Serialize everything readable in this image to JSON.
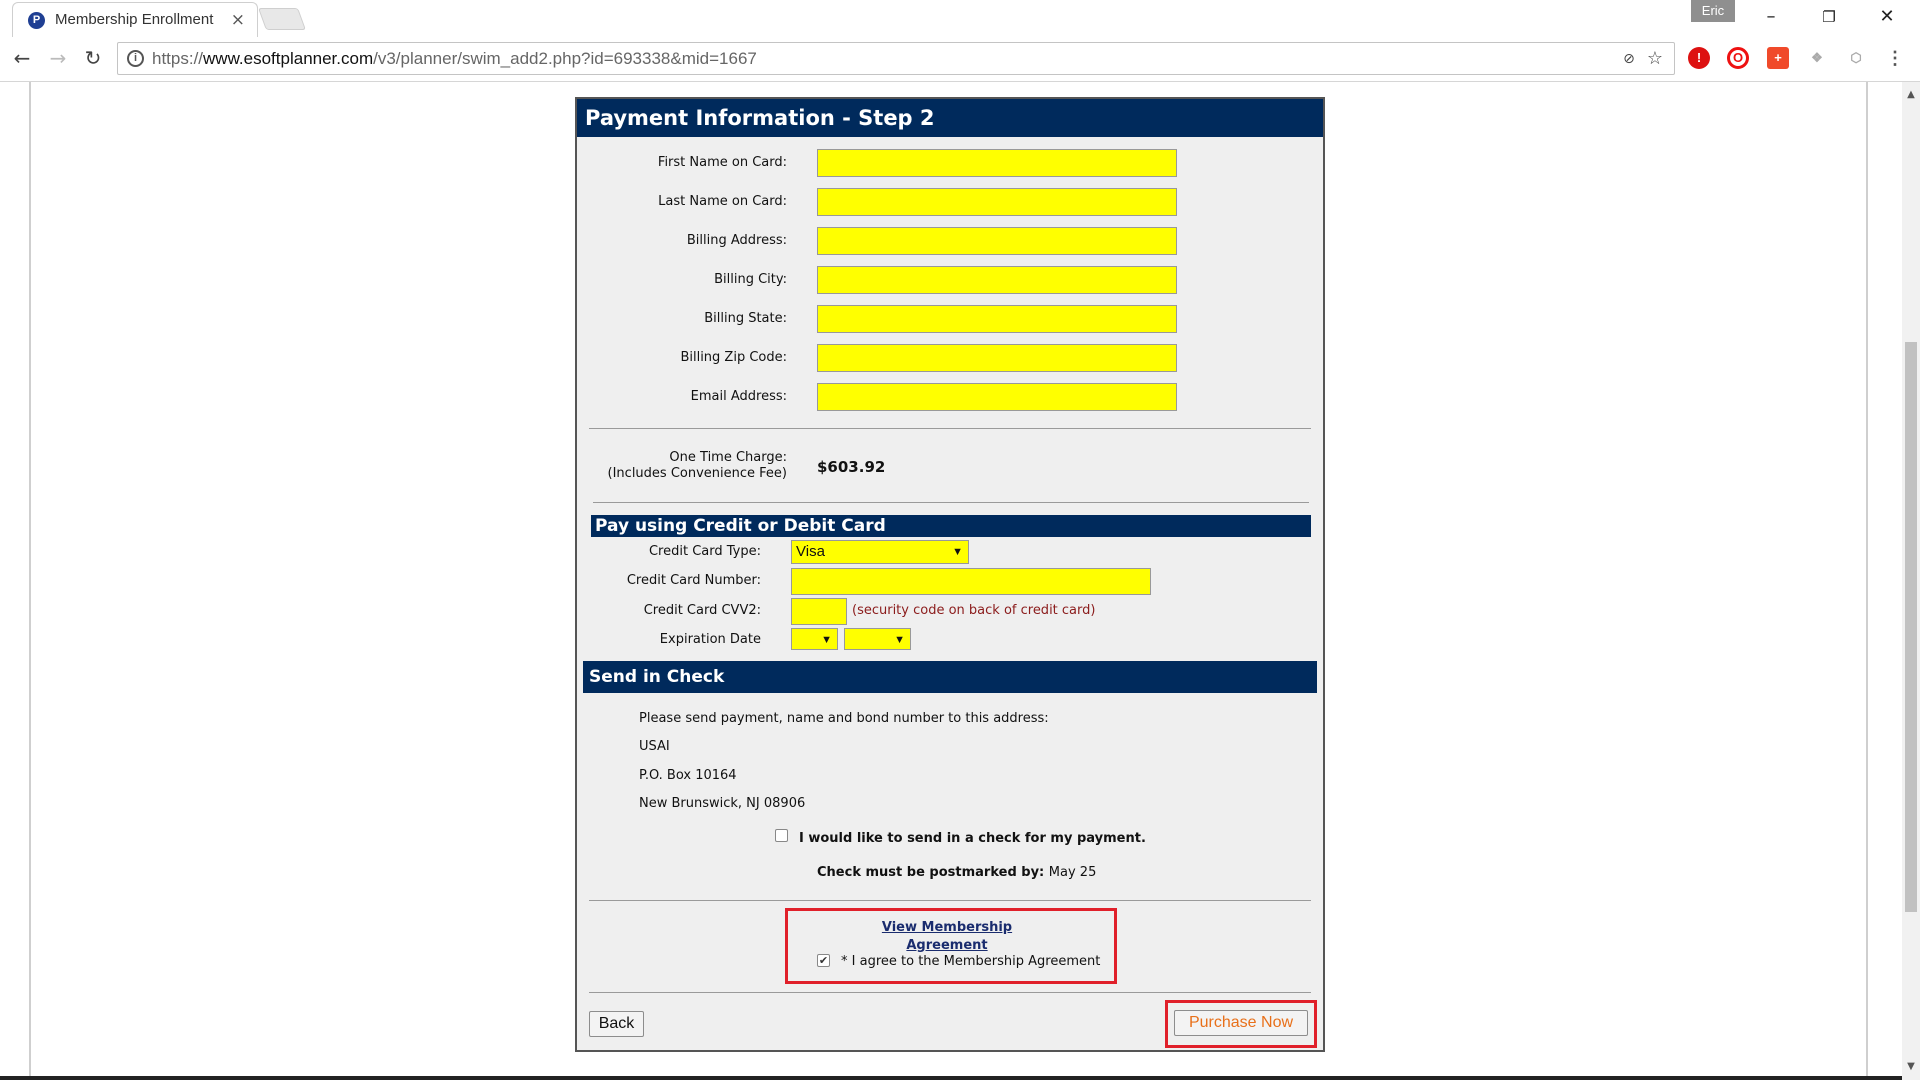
{
  "browser": {
    "tab_title": "Membership Enrollment",
    "tab_favicon": "P",
    "tab_close": "×",
    "profile_name": "Eric",
    "url_prefix": "https://",
    "url_host": "www.esoftplanner.com",
    "url_path": "/v3/planner/swim_add2.php?id=693338&mid=1667",
    "window_buttons": {
      "minimize": "–",
      "restore": "❐",
      "close": "✕"
    },
    "nav": {
      "back": "←",
      "forward": "→",
      "reload": "↻"
    }
  },
  "form": {
    "header": "Payment Information - Step 2",
    "fields": [
      {
        "label": "First Name on Card:",
        "value": ""
      },
      {
        "label": "Last Name on Card:",
        "value": ""
      },
      {
        "label": "Billing Address:",
        "value": ""
      },
      {
        "label": "Billing City:",
        "value": ""
      },
      {
        "label": "Billing State:",
        "value": ""
      },
      {
        "label": "Billing Zip Code:",
        "value": ""
      },
      {
        "label": "Email Address:",
        "value": ""
      }
    ],
    "charge_label_line1": "One Time Charge:",
    "charge_label_line2": "(Includes Convenience Fee)",
    "charge_amount": "$603.92"
  },
  "credit_card": {
    "section_title": "Pay using Credit or Debit Card",
    "type_label": "Credit Card Type:",
    "type_value": "Visa",
    "number_label": "Credit Card Number:",
    "number_value": "",
    "cvv_label": "Credit Card CVV2:",
    "cvv_value": "",
    "cvv_note": "(security code on back of credit card)",
    "expiration_label": "Expiration Date",
    "expiration_month": "",
    "expiration_year": ""
  },
  "check": {
    "section_title": "Send in Check",
    "instruction": "Please send payment, name and bond number to this address:",
    "address_line1": "USAI",
    "address_line2": "P.O. Box 10164",
    "address_line3": "New Brunswick, NJ 08906",
    "checkbox_label": "I would like to send in a check for my payment.",
    "checkbox_checked": false,
    "postmark_label": "Check must be postmarked by:",
    "postmark_date": "May 25"
  },
  "agreement": {
    "link_text": "View Membership Agreement",
    "checkbox_label": "* I agree to the Membership Agreement",
    "checkbox_checked": true
  },
  "buttons": {
    "back": "Back",
    "purchase": "Purchase Now"
  },
  "colors": {
    "header_navy": "#002a5c",
    "input_yellow": "#ffff00",
    "highlight_red": "#e0202a",
    "purchase_text": "#e8701a",
    "cvv_note": "#8b1c1c"
  }
}
